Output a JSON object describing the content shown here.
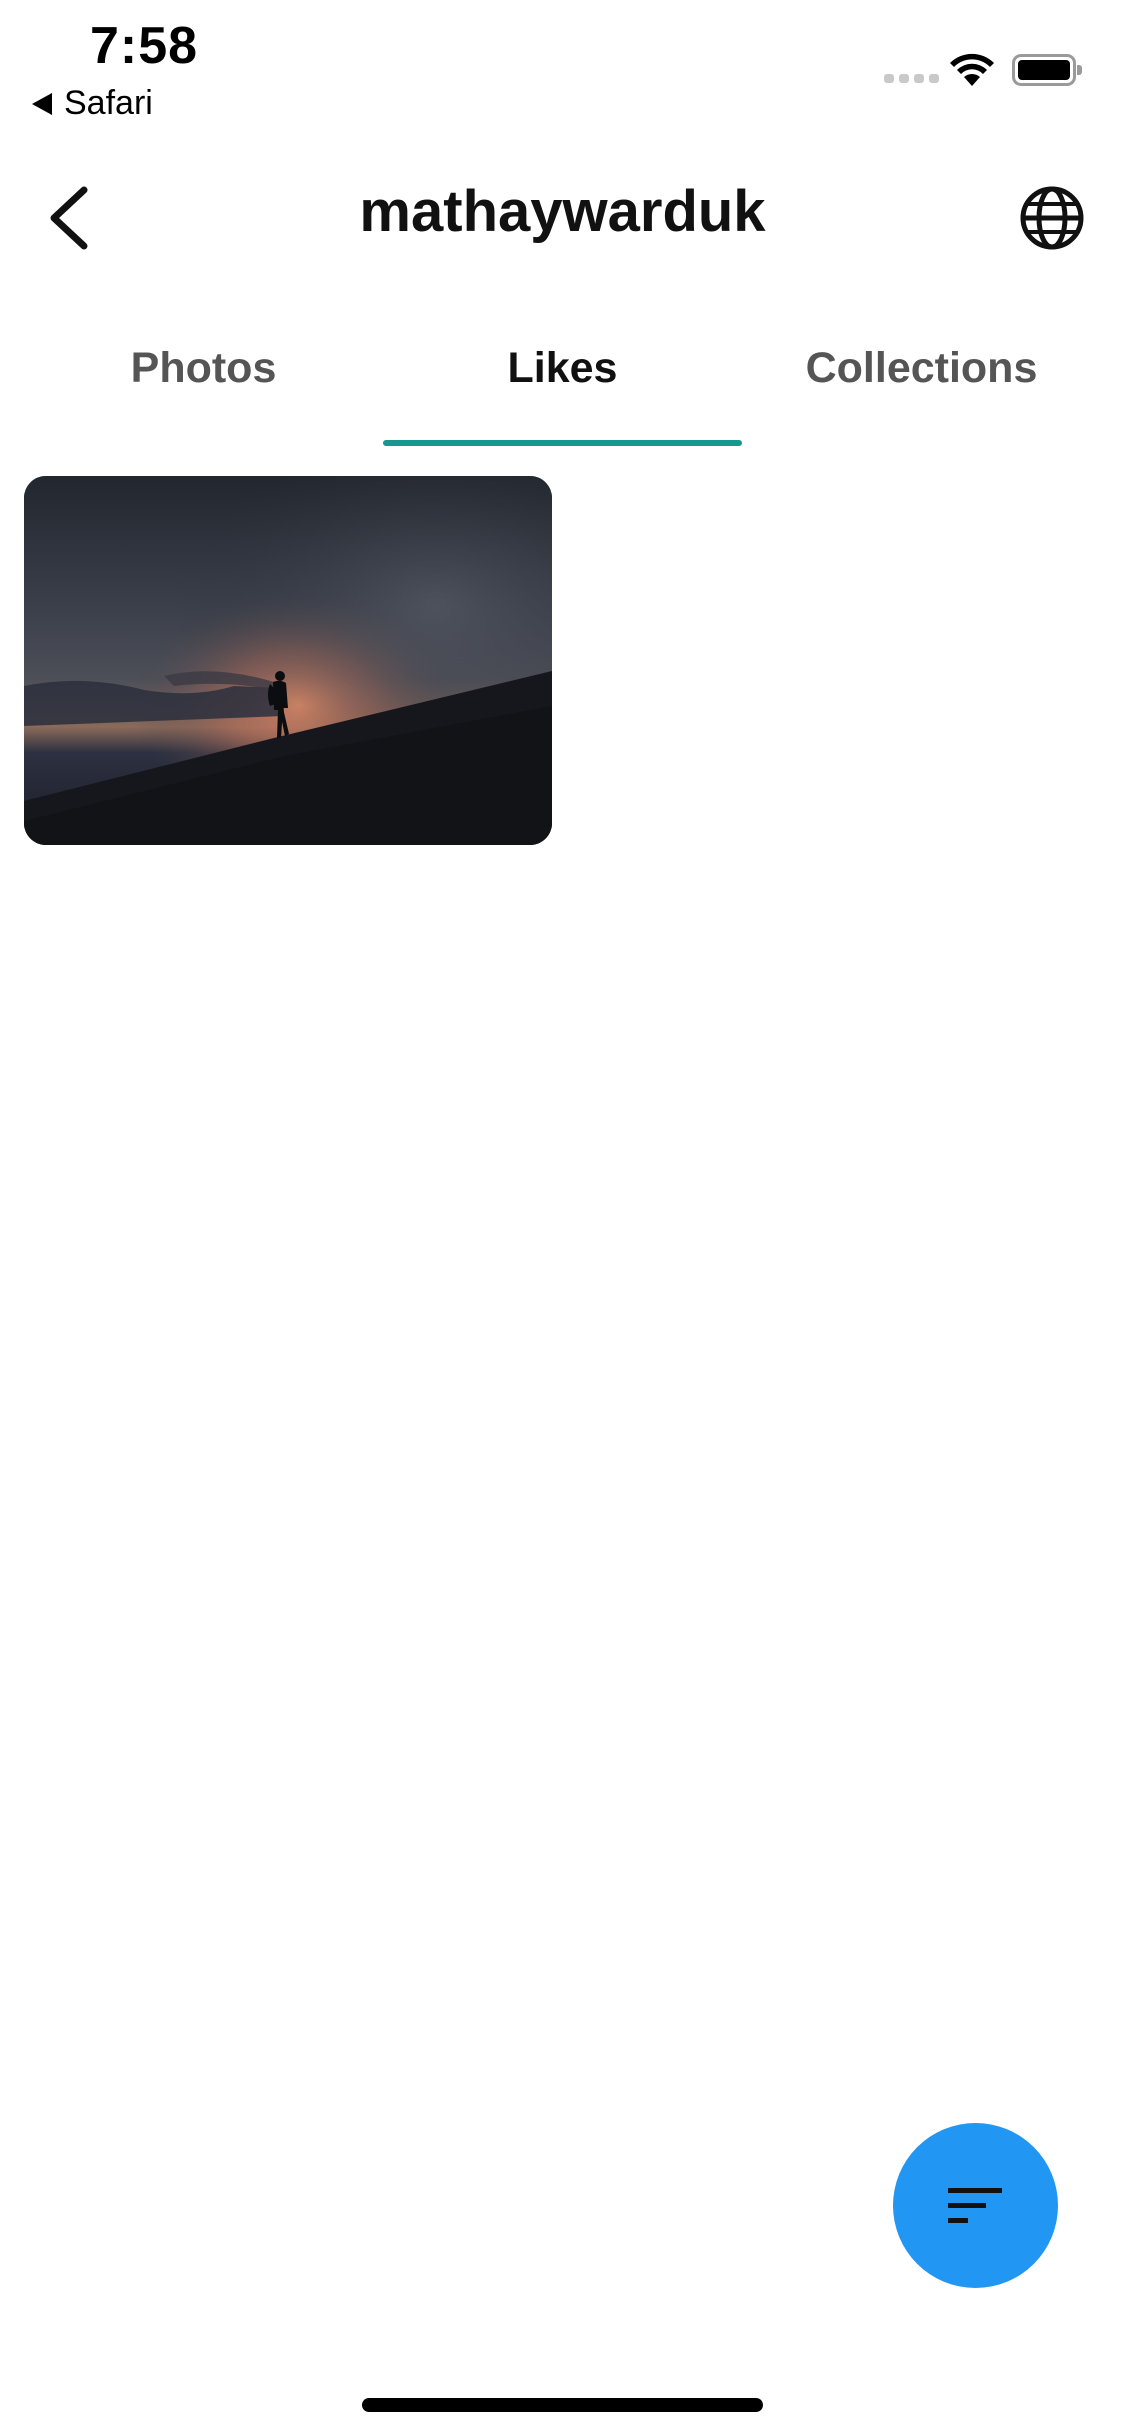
{
  "status_bar": {
    "time": "7:58",
    "back_app": "Safari"
  },
  "header": {
    "title": "mathaywarduk",
    "back_icon": "chevron-left-icon",
    "globe_icon": "globe-icon"
  },
  "tabs": [
    {
      "label": "Photos",
      "active": false
    },
    {
      "label": "Likes",
      "active": true
    },
    {
      "label": "Collections",
      "active": false
    }
  ],
  "accent_color": "#17978e",
  "fab": {
    "icon": "sort-icon",
    "color": "#2196f3"
  },
  "photos": [
    {
      "description_icon": "photo-thumbnail"
    }
  ]
}
